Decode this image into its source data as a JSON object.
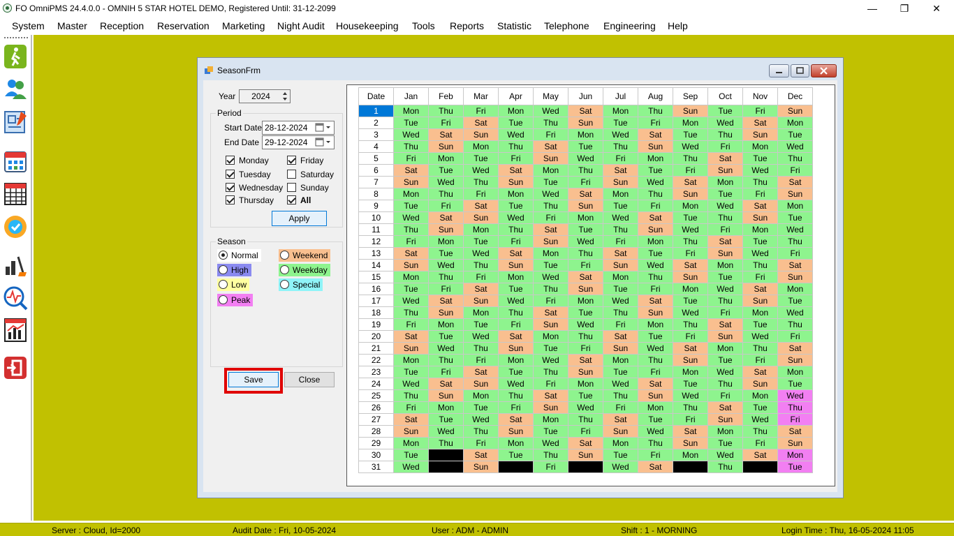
{
  "app_title": "FO OmniPMS 24.4.0.0 - OMNIH 5 STAR HOTEL DEMO, Registered Until: 31-12-2099",
  "window_controls": {
    "minimize": "—",
    "restore": "❐",
    "close": "✕"
  },
  "menu": [
    "System",
    "Master",
    "Reception",
    "Reservation",
    "Marketing",
    "Night Audit",
    "Housekeeping",
    "Tools",
    "Reports",
    "Statistic",
    "Telephone",
    "Engineering",
    "Help"
  ],
  "sidebar_icons": [
    "walk-in-icon",
    "guests-icon",
    "floor-plan-icon",
    "calendar-grid-icon",
    "year-calendar-icon",
    "approval-badge-icon",
    "housekeeping-icon",
    "analytics-icon",
    "chart-report-icon",
    "exit-icon"
  ],
  "form": {
    "title": "SeasonFrm",
    "year_label": "Year",
    "year_value": "2024",
    "period_label": "Period",
    "start_label": "Start Date",
    "start_value": "28-12-2024",
    "end_label": "End Date",
    "end_value": "29-12-2024",
    "days": [
      {
        "label": "Monday",
        "checked": true
      },
      {
        "label": "Friday",
        "checked": true
      },
      {
        "label": "Tuesday",
        "checked": true
      },
      {
        "label": "Saturday",
        "checked": false
      },
      {
        "label": "Wednesday",
        "checked": true
      },
      {
        "label": "Sunday",
        "checked": false
      },
      {
        "label": "Thursday",
        "checked": true
      },
      {
        "label": "All",
        "checked": true
      }
    ],
    "apply_label": "Apply",
    "season_label": "Season",
    "seasons": [
      {
        "label": "Normal",
        "color": "#ffffff",
        "selected": true
      },
      {
        "label": "Weekend",
        "color": "#f9bf8f",
        "selected": false
      },
      {
        "label": "High",
        "color": "#8a8af0",
        "selected": false
      },
      {
        "label": "Weekday",
        "color": "#8ef48e",
        "selected": false
      },
      {
        "label": "Low",
        "color": "#ffffa0",
        "selected": false
      },
      {
        "label": "Special",
        "color": "#8ff4f8",
        "selected": false
      },
      {
        "label": "Peak",
        "color": "#f27ff2",
        "selected": false
      }
    ],
    "save_label": "Save",
    "close_label": "Close"
  },
  "calendar": {
    "headers": [
      "Date",
      "Jan",
      "Feb",
      "Mar",
      "Apr",
      "May",
      "Jun",
      "Jul",
      "Aug",
      "Sep",
      "Oct",
      "Nov",
      "Dec"
    ],
    "colors": {
      "weekday": "#8ef48e",
      "weekend": "#f9bf8f",
      "peak": "#f27ff2",
      "none": "#000000"
    },
    "peak_dec_days": [
      25,
      26,
      27,
      30,
      31
    ],
    "selected_date": 1
  },
  "status": {
    "server": "Server : Cloud, Id=2000",
    "audit": "Audit Date : Fri, 10-05-2024",
    "user": "User : ADM - ADMIN",
    "shift": "Shift : 1 - MORNING",
    "login": "Login Time : Thu, 16-05-2024 11:05"
  }
}
